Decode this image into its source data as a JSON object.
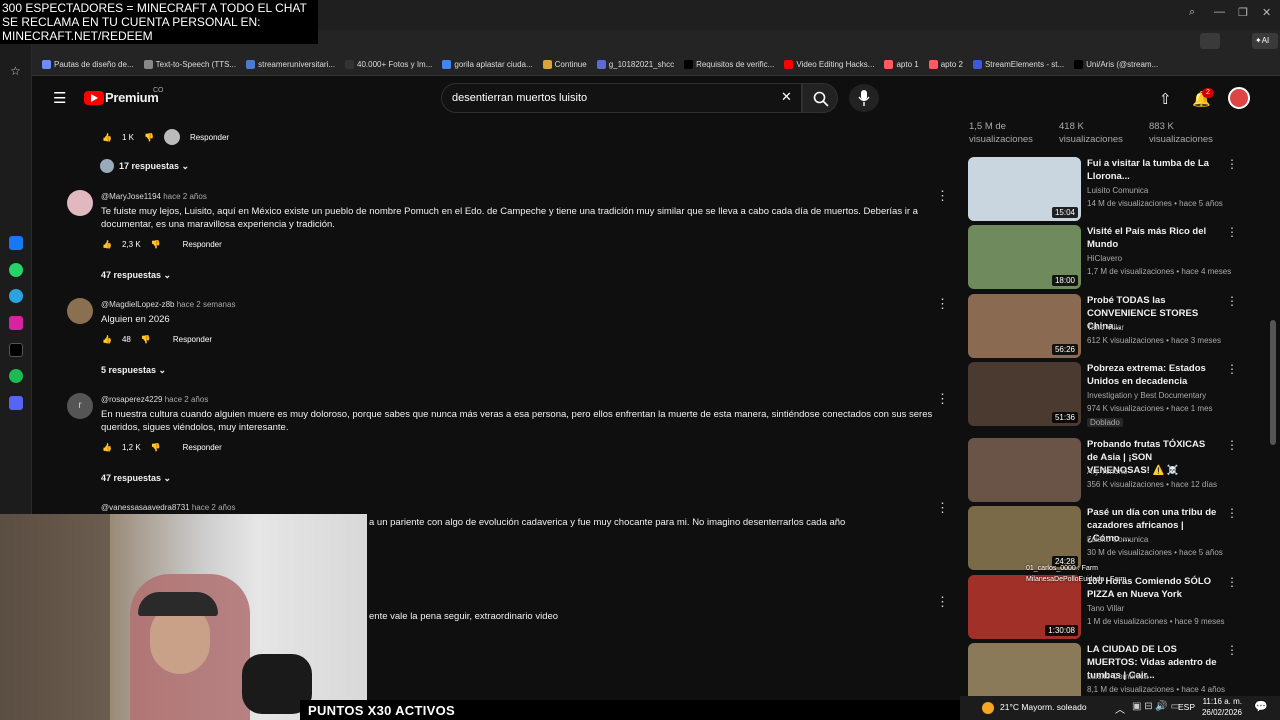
{
  "overlay": {
    "line1": "300 ESPECTADORES = MINECRAFT A TODO EL CHAT",
    "line2": "SE RECLAMA EN TU CUENTA PERSONAL EN:",
    "line3": "MINECRAFT.NET/REDEEM"
  },
  "bookmarks": [
    {
      "label": "Pautas de diseño de...",
      "color": "#6c8cff"
    },
    {
      "label": "Text-to-Speech (TTS...",
      "color": "#888888"
    },
    {
      "label": "streameruniversitari...",
      "color": "#4a7bd0"
    },
    {
      "label": "40.000+ Fotos y Im...",
      "color": "#333333"
    },
    {
      "label": "gorila aplastar ciuda...",
      "color": "#4285f4"
    },
    {
      "label": "Continue",
      "color": "#d9a441"
    },
    {
      "label": "g_10182021_shcc",
      "color": "#5b6bd0"
    },
    {
      "label": "Requisitos de verific...",
      "color": "#000000"
    },
    {
      "label": "Video Editing Hacks...",
      "color": "#ff0000"
    },
    {
      "label": "apto 1",
      "color": "#ff5a5f"
    },
    {
      "label": "apto 2",
      "color": "#ff5a5f"
    },
    {
      "label": "StreamElements - st...",
      "color": "#3b5bd6"
    },
    {
      "label": "Uni/Aris (@stream...",
      "color": "#000000"
    }
  ],
  "header": {
    "logo": "Premium",
    "logo_sup": "CO",
    "search_value": "desentierran muertos luisito",
    "notif_count": "2"
  },
  "comments": {
    "top_likes": "1 K",
    "top_reply": "Responder",
    "top_replies": "17 respuestas",
    "c1": {
      "user": "@MaryJose1194",
      "time": "hace 2 años",
      "text": "Te fuiste muy lejos, Luisito, aquí en México existe un pueblo de nombre Pomuch en el Edo. de Campeche y tiene una tradición muy similar que se lleva a cabo cada día de muertos. Deberías ir a documentar, es una maravillosa experiencia y tradición.",
      "likes": "2,3 K",
      "reply": "Responder",
      "replies": "47 respuestas"
    },
    "c2": {
      "user": "@MagdielLopez-z8b",
      "time": "hace 2 semanas",
      "text": "Alguien en 2026",
      "likes": "48",
      "reply": "Responder",
      "replies": "5 respuestas"
    },
    "c3": {
      "user": "@rosaperez4229",
      "time": "hace 2 años",
      "avatar": "r",
      "text": "En nuestra cultura cuando alguien muere es muy doloroso, porque sabes que nunca más veras a esa persona, pero ellos enfrentan la muerte de esta manera, sintiéndose conectados con sus seres queridos, sigues viéndolos, muy interesante.",
      "likes": "1,2 K",
      "reply": "Responder",
      "replies": "47 respuestas"
    },
    "c4": {
      "user": "@vanessasaavedra8731",
      "time": "hace 2 años",
      "text": "a un pariente con algo de evolución cadaverica y fue muy chocante para mi. No imagino desenterrarlos cada año"
    },
    "c5": {
      "text": "ente vale la pena seguir, extraordinario video"
    }
  },
  "views_top": [
    "1,5 M de visualizaciones",
    "418 K visualizaciones",
    "883 K visualizaciones"
  ],
  "videos": [
    {
      "title": "Fui a visitar la tumba de La Llorona...",
      "channel": "Luisito Comunica",
      "meta": "14 M de visualizaciones • hace 5 años",
      "duration": "15:04",
      "thumb": "#c9d6e0"
    },
    {
      "title": "Visité el País más Rico del Mundo",
      "channel": "HiClavero",
      "meta": "1,7 M de visualizaciones • hace 4 meses",
      "duration": "18:00",
      "thumb": "#6f8a5c"
    },
    {
      "title": "Probé TODAS las CONVENIENCE STORES China...",
      "channel": "Tano Villar",
      "meta": "612 K visualizaciones • hace 3 meses",
      "duration": "56:26",
      "thumb": "#8a6a50"
    },
    {
      "title": "Pobreza extrema: Estados Unidos en decadencia",
      "channel": "Investigation y Best Documentary",
      "meta": "974 K visualizaciones • hace 1 mes",
      "duration": "51:36",
      "badge": "Doblado",
      "thumb": "#4a3a30"
    },
    {
      "title": "Probando frutas TÓXICAS de Asia | ¡SON VENENOSAS! ⚠️ ☠️",
      "channel": "Ary Tenorio",
      "meta": "356 K visualizaciones • hace 12 días",
      "duration": "",
      "thumb": "#6a5448"
    },
    {
      "title": "Pasé un día con una tribu de cazadores africanos | ¿Cómo ...",
      "channel": "Luisito Comunica",
      "meta": "30 M de visualizaciones • hace 5 años",
      "duration": "24:28",
      "thumb": "#7a6a48"
    },
    {
      "title": "100 Horas Comiendo SÓLO PIZZA en Nueva York",
      "channel": "Tano Villar",
      "meta": "1 M de visualizaciones • hace 9 meses",
      "duration": "1:30:08",
      "thumb": "#a03028"
    },
    {
      "title": "LA CIUDAD DE LOS MUERTOS: Vidas adentro de tumbas | Cair...",
      "channel": "Luisito Comunica",
      "meta": "8,1 M de visualizaciones • hace 4 años",
      "duration": "",
      "thumb": "#8a7a5a"
    }
  ],
  "chat_overlay": {
    "line1": "01_carlos_0000 : Farm",
    "line2": "MilanesaDePolloEuidada : Farm"
  },
  "banner": "PUNTOS X30 ACTIVOS",
  "taskbar": {
    "weather": "21°C  Mayorm. soleado",
    "lang": "ESP",
    "time": "11:16 a. m.",
    "date": "26/02/2026"
  }
}
